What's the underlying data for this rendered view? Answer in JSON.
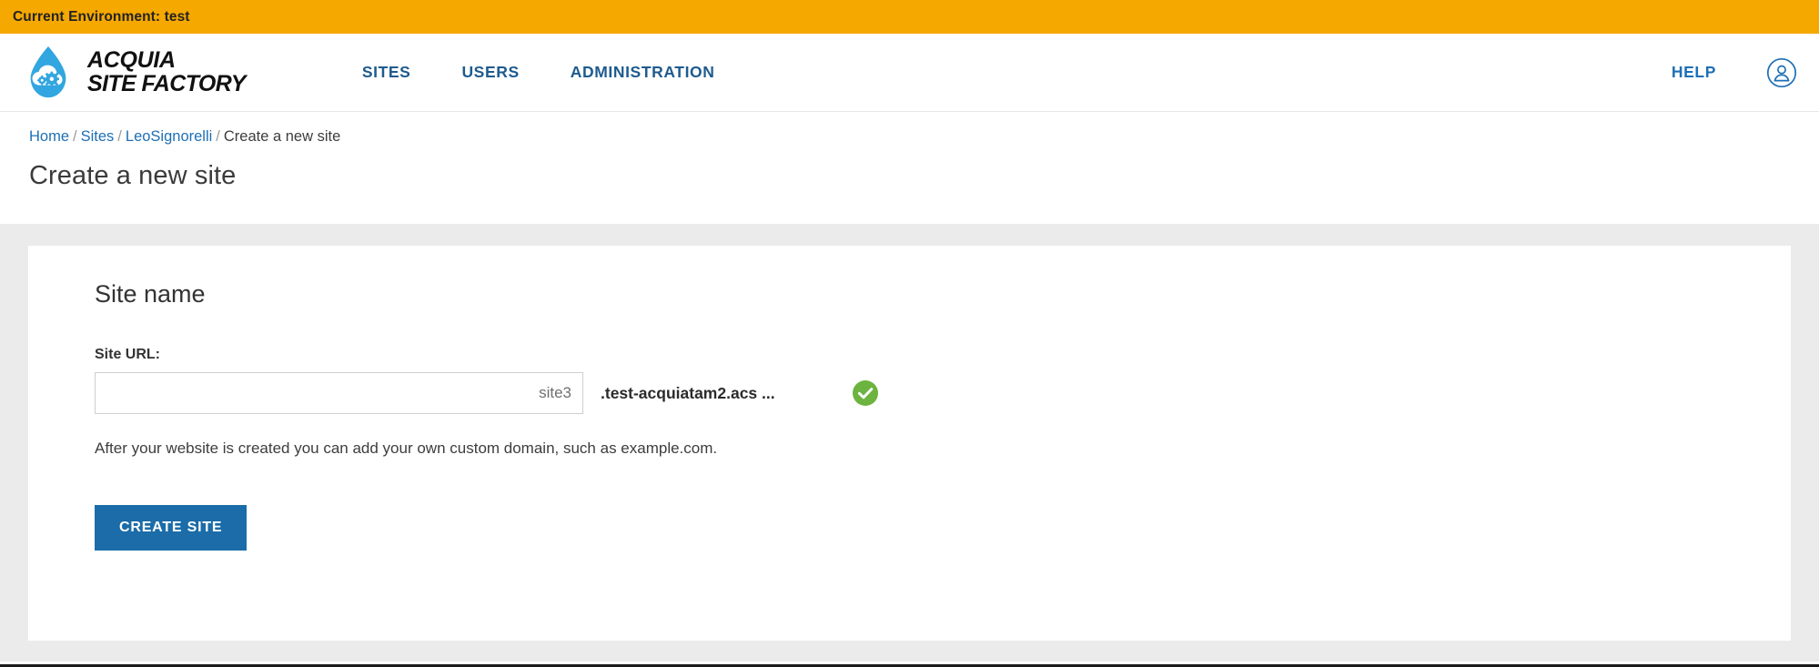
{
  "env_banner": {
    "text": "Current Environment: test",
    "background": "#f5a800"
  },
  "header": {
    "logo": {
      "icon": "acquia-droplet-logo",
      "line1": "ACQUIA",
      "line2": "SITE FACTORY",
      "color": "#32a6e0"
    },
    "nav": [
      {
        "label": "SITES",
        "name": "nav-link-sites"
      },
      {
        "label": "USERS",
        "name": "nav-link-users"
      },
      {
        "label": "ADMINISTRATION",
        "name": "nav-link-administration"
      }
    ],
    "help_label": "HELP",
    "account_icon": "user-account-icon",
    "link_color": "#1e5b8e"
  },
  "breadcrumb": {
    "items": [
      {
        "label": "Home",
        "link": true
      },
      {
        "label": "Sites",
        "link": true
      },
      {
        "label": "LeoSignorelli",
        "link": true
      },
      {
        "label": "Create a new site",
        "link": false
      }
    ],
    "separator": "/"
  },
  "page_title": "Create a new site",
  "card": {
    "title": "Site name",
    "field": {
      "label": "Site URL:",
      "input_value": "",
      "input_placeholder": "site3",
      "suffix": ".test-acquiatam2.acs ...",
      "status_icon": "green-check-circle-icon",
      "status_color": "#6cb33f"
    },
    "help_text": "After your website is created you can add your own custom domain, such as example.com.",
    "submit_label": "CREATE SITE",
    "submit_color": "#1b6ca8"
  }
}
